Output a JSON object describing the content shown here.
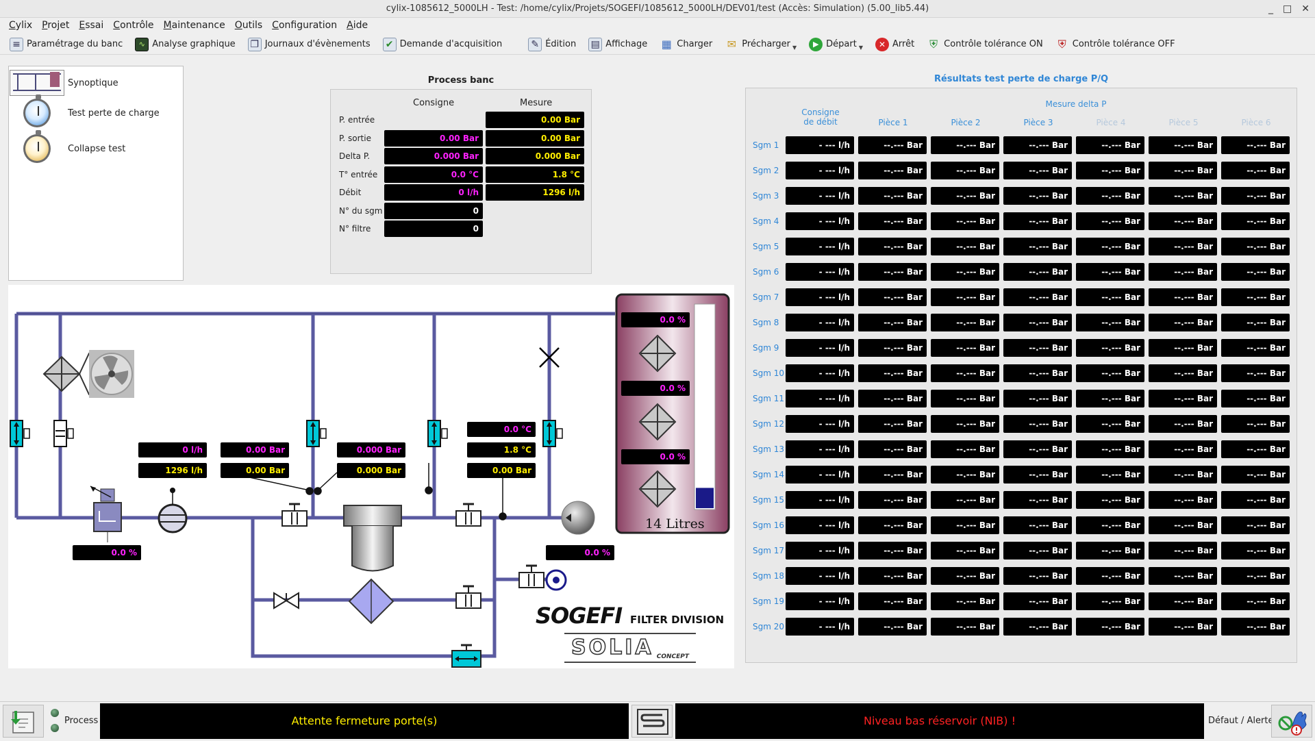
{
  "window": {
    "title": "cylix-1085612_5000LH - Test: /home/cylix/Projets/SOGEFI/1085612_5000LH/DEV01/test (Accès: Simulation) (5.00_lib5.44)",
    "buttons": [
      "_",
      "□",
      "✕"
    ]
  },
  "menu": [
    "Cylix",
    "Projet",
    "Essai",
    "Contrôle",
    "Maintenance",
    "Outils",
    "Configuration",
    "Aide"
  ],
  "toolbar": {
    "parametrage": "Paramétrage du banc",
    "analyse": "Analyse graphique",
    "journaux": "Journaux d'évènements",
    "demande": "Demande d'acquisition",
    "edition": "Édition",
    "affichage": "Affichage",
    "charger": "Charger",
    "precharger": "Précharger",
    "depart": "Départ",
    "arret": "Arrêt",
    "tol_on": "Contrôle tolérance ON",
    "tol_off": "Contrôle tolérance OFF"
  },
  "nav": {
    "items": [
      {
        "label": "Synoptique"
      },
      {
        "label": "Test perte de charge"
      },
      {
        "label": "Collapse test"
      }
    ]
  },
  "process_banc": {
    "title": "Process banc",
    "col_consigne": "Consigne",
    "col_mesure": "Mesure",
    "rows": [
      {
        "label": "P. entrée",
        "consigne": null,
        "mesure": "0.00 Bar"
      },
      {
        "label": "P. sortie",
        "consigne": "0.00 Bar",
        "mesure": "0.00 Bar"
      },
      {
        "label": "Delta P.",
        "consigne": "0.000 Bar",
        "mesure": "0.000 Bar"
      },
      {
        "label": "T° entrée",
        "consigne": "0.0 °C",
        "mesure": "1.8 °C"
      },
      {
        "label": "Débit",
        "consigne": "0 l/h",
        "mesure": "1296 l/h"
      },
      {
        "label": "N° du sgm",
        "consigne": "0",
        "mesure": null
      },
      {
        "label": "N° filtre",
        "consigne": "0",
        "mesure": null
      }
    ]
  },
  "synoptic": {
    "flow_consigne": "0 l/h",
    "flow_mesure": "1296 l/h",
    "pin_consigne": "0.00 Bar",
    "pin_mesure": "0.00 Bar",
    "dp_consigne": "0.000 Bar",
    "dp_mesure": "0.000 Bar",
    "temp_consigne": "0.0 °C",
    "temp_mesure": "1.8 °C",
    "pout_mesure": "0.00 Bar",
    "valve_pct": "0.0 %",
    "pump_pct": "0.0 %",
    "tank_valve_1": "0.0 %",
    "tank_valve_2": "0.0 %",
    "tank_valve_3": "0.0 %",
    "tank_label": "14 Litres",
    "tank_level": 0.1,
    "brand_sogefi": "SOGEFI",
    "brand_division": "FILTER DIVISION",
    "brand_solia": "SOLIA",
    "brand_solia_sub": "CONCEPT",
    "colors": {
      "pipe": "#5a5aa0",
      "cyan": "#00c8d8",
      "tank": "#a05a78",
      "magenta": "#ff22ff",
      "yellow": "#ffee00"
    }
  },
  "results": {
    "title": "Résultats test perte de charge P/Q",
    "col_consigne_line1": "Consigne",
    "col_consigne_line2": "de débit",
    "mesure_header": "Mesure delta P",
    "pieces": [
      "Pièce 1",
      "Pièce 2",
      "Pièce 3",
      "Pièce 4",
      "Pièce 5",
      "Pièce 6"
    ],
    "pieces_dim": [
      false,
      false,
      false,
      true,
      true,
      true
    ],
    "flow_placeholder": "- --- l/h",
    "bar_placeholder": "--.--- Bar",
    "rows": [
      "Sgm 1",
      "Sgm 2",
      "Sgm 3",
      "Sgm 4",
      "Sgm 5",
      "Sgm 6",
      "Sgm 7",
      "Sgm 8",
      "Sgm 9",
      "Sgm 10",
      "Sgm 11",
      "Sgm 12",
      "Sgm 13",
      "Sgm 14",
      "Sgm 15",
      "Sgm 16",
      "Sgm 17",
      "Sgm 18",
      "Sgm 19",
      "Sgm 20"
    ]
  },
  "statusbar": {
    "process_label": "Process",
    "message_left": "Attente fermeture porte(s)",
    "message_right": "Niveau bas réservoir (NIB) !",
    "defaut_label": "Défaut / Alerte",
    "message_left_color": "#ffee00",
    "message_right_color": "#ff2222"
  }
}
